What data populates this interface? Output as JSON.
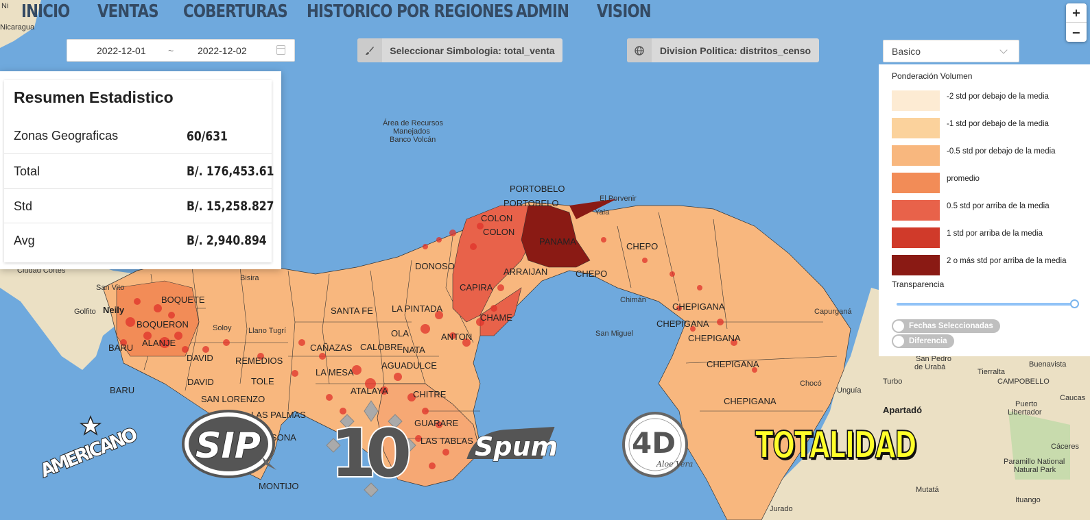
{
  "nav": {
    "items": [
      "INICIO",
      "VENTAS",
      "COBERTURAS",
      "HISTORICO POR REGIONES",
      "ADMIN",
      "VISION"
    ]
  },
  "zoom": {
    "in": "+",
    "out": "−"
  },
  "date_range": {
    "start": "2022-12-01",
    "separator": "~",
    "end": "2022-12-02"
  },
  "symbology_button": {
    "label": "Seleccionar Simbologia: total_venta",
    "icon": "brush-icon"
  },
  "division_button": {
    "label": "Division Politica: distritos_censo",
    "icon": "globe-icon"
  },
  "base_select": {
    "value": "Basico"
  },
  "stats": {
    "title": "Resumen Estadistico",
    "rows": [
      {
        "label": "Zonas Geograficas",
        "value": "60/631"
      },
      {
        "label": "Total",
        "value": "B/. 176,453.61"
      },
      {
        "label": "Std",
        "value": "B/. 15,258.827"
      },
      {
        "label": "Avg",
        "value": "B/. 2,940.894"
      }
    ]
  },
  "legend": {
    "title": "Ponderación Volumen",
    "items": [
      {
        "label": "-2 std por debajo de la media",
        "color": "#fdebd3"
      },
      {
        "label": "-1 std por debajo de la media",
        "color": "#fbd29c"
      },
      {
        "label": "-0.5 std por debajo de la media",
        "color": "#f8b77e"
      },
      {
        "label": "promedio",
        "color": "#f28c57"
      },
      {
        "label": "0.5 std por arriba de la media",
        "color": "#e8624a"
      },
      {
        "label": "1 std por arriba de la media",
        "color": "#d03a2a"
      },
      {
        "label": "2 o más std por arriba de la media",
        "color": "#8a1a14"
      }
    ],
    "transparency_label": "Transparencia",
    "transparency_value": 1.0,
    "toggles": [
      {
        "label": "Fechas Seleccionadas",
        "on": false
      },
      {
        "label": "Diferencia",
        "on": false
      }
    ]
  },
  "map": {
    "labels": [
      "Nicaragua",
      "Área de Recursos",
      "Manejados",
      "Banco Volcán",
      "PORTOBELO",
      "PORTOBELO",
      "El Porvenir",
      "COLON",
      "COLON",
      "PANAMA",
      "Yala",
      "CHEPO",
      "CHEPO",
      "DONOSO",
      "ARRAIJAN",
      "CAPIRA",
      "CHAME",
      "LA PINTADA",
      "SANTA FE",
      "OLA",
      "ANTON",
      "NATA",
      "CALOBRE",
      "CAÑAZAS",
      "LA MESA",
      "AGUADULCE",
      "ATALAYA",
      "CHITRE",
      "GUARARE",
      "LAS TABLAS",
      "LAS PALMAS",
      "SONA",
      "MONTIJO",
      "TOLE",
      "REMEDIOS",
      "DAVID",
      "DAVID",
      "SAN LORENZO",
      "BARU",
      "BARU",
      "ALANJE",
      "BOQUERON",
      "BOQUETE",
      "Neily",
      "Golfito",
      "San Vito",
      "Ciudad Cortés",
      "Bisira",
      "Llano Tugrí",
      "Soloy",
      "Chimán",
      "San Miguel",
      "CHEPIGANA",
      "CHEPIGANA",
      "CHEPIGANA",
      "CHEPIGANA",
      "CHEPIGANA",
      "Capurganá",
      "San Pedro de Urabá",
      "Turbo",
      "Unguía",
      "Tierralta",
      "Buenavista",
      "CAMPOBELLO",
      "Puerto Libertador",
      "Apartadó",
      "Caucas",
      "Cáceres",
      "Paramillo National",
      "Natural Park",
      "Mutatá",
      "Jurado",
      "Ituango",
      "Chocó"
    ]
  },
  "logos": {
    "americano": "AMERICANO",
    "sip": "SIP",
    "ten": "10",
    "spum": "Spum",
    "four_d": "4D",
    "four_d_sub": "Aloe Vera",
    "totalidad": "TOTALIDAD"
  }
}
